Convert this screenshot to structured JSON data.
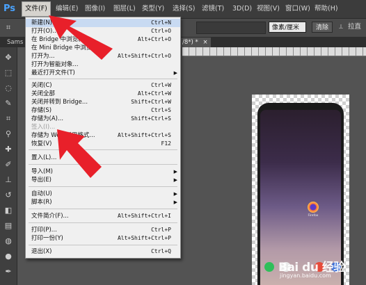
{
  "app": {
    "logo": "Ps"
  },
  "menubar": {
    "items": [
      "文件(F)",
      "编辑(E)",
      "图像(I)",
      "图层(L)",
      "类型(Y)",
      "选择(S)",
      "滤镜(T)",
      "3D(D)",
      "视图(V)",
      "窗口(W)",
      "帮助(H)"
    ],
    "active_index": 0
  },
  "options_bar": {
    "units_select": "像素/厘米",
    "clear_button": "清除",
    "straighten_label": "拉直"
  },
  "tabs": {
    "left_tab": "Sams",
    "current_tab": "/8*) *",
    "close_glyph": "×"
  },
  "file_menu": {
    "items": [
      {
        "label": "新建(N)...",
        "shortcut": "Ctrl+N"
      },
      {
        "label": "打开(O)...",
        "shortcut": "Ctrl+O"
      },
      {
        "label": "在 Bridge 中浏览(B)...",
        "shortcut": "Alt+Ctrl+O"
      },
      {
        "label": "在 Mini Bridge 中浏览(G)...",
        "shortcut": ""
      },
      {
        "label": "打开为...",
        "shortcut": "Alt+Shift+Ctrl+O"
      },
      {
        "label": "打开为智能对象...",
        "shortcut": ""
      },
      {
        "label": "最近打开文件(T)",
        "shortcut": "",
        "submenu": true
      },
      {
        "label": "关闭(C)",
        "shortcut": "Ctrl+W"
      },
      {
        "label": "关闭全部",
        "shortcut": "Alt+Ctrl+W"
      },
      {
        "label": "关闭并转到 Bridge...",
        "shortcut": "Shift+Ctrl+W"
      },
      {
        "label": "存储(S)",
        "shortcut": "Ctrl+S"
      },
      {
        "label": "存储为(A)...",
        "shortcut": "Shift+Ctrl+S"
      },
      {
        "label": "签入(I)...",
        "shortcut": "",
        "disabled": true
      },
      {
        "label": "存储为 Web 所用格式...",
        "shortcut": "Alt+Shift+Ctrl+S"
      },
      {
        "label": "恢复(V)",
        "shortcut": "F12"
      },
      {
        "label": "置入(L)...",
        "shortcut": ""
      },
      {
        "label": "导入(M)",
        "shortcut": "",
        "submenu": true
      },
      {
        "label": "导出(E)",
        "shortcut": "",
        "submenu": true
      },
      {
        "label": "自动(U)",
        "shortcut": "",
        "submenu": true
      },
      {
        "label": "脚本(R)",
        "shortcut": "",
        "submenu": true
      },
      {
        "label": "文件简介(F)...",
        "shortcut": "Alt+Shift+Ctrl+I"
      },
      {
        "label": "打印(P)...",
        "shortcut": "Ctrl+P"
      },
      {
        "label": "打印一份(Y)",
        "shortcut": "Alt+Shift+Ctrl+P"
      },
      {
        "label": "退出(X)",
        "shortcut": "Ctrl+Q"
      }
    ]
  },
  "canvas": {
    "app_label": "Firefox"
  },
  "watermark": {
    "main": "Bai du 经验",
    "sub": "jingyan.baidu.com"
  },
  "colors": {
    "arrow": "#e8202a",
    "menu_bg": "#f0f0f0",
    "accent": "#4aa3ff"
  }
}
